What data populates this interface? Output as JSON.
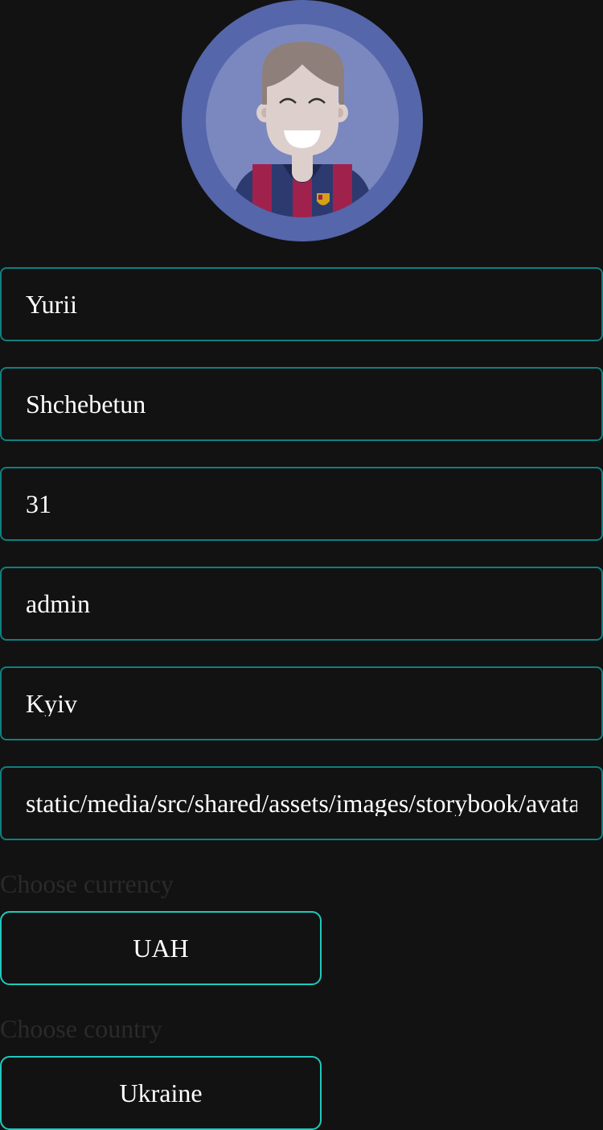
{
  "profile": {
    "avatar_icon": "user-avatar-icon",
    "first_name": "Yurii",
    "last_name": "Shchebetun",
    "age": "31",
    "role": "admin",
    "city": "Kyiv",
    "avatar_path": "static/media/src/shared/assets/images/storybook/avata"
  },
  "currency": {
    "label": "Choose currency",
    "selected": "UAH"
  },
  "country": {
    "label": "Choose country",
    "selected": "Ukraine"
  },
  "colors": {
    "background": "#121212",
    "field_border": "#0f7f80",
    "select_border": "#1fc9bd",
    "avatar_ring": "#5566aa"
  }
}
